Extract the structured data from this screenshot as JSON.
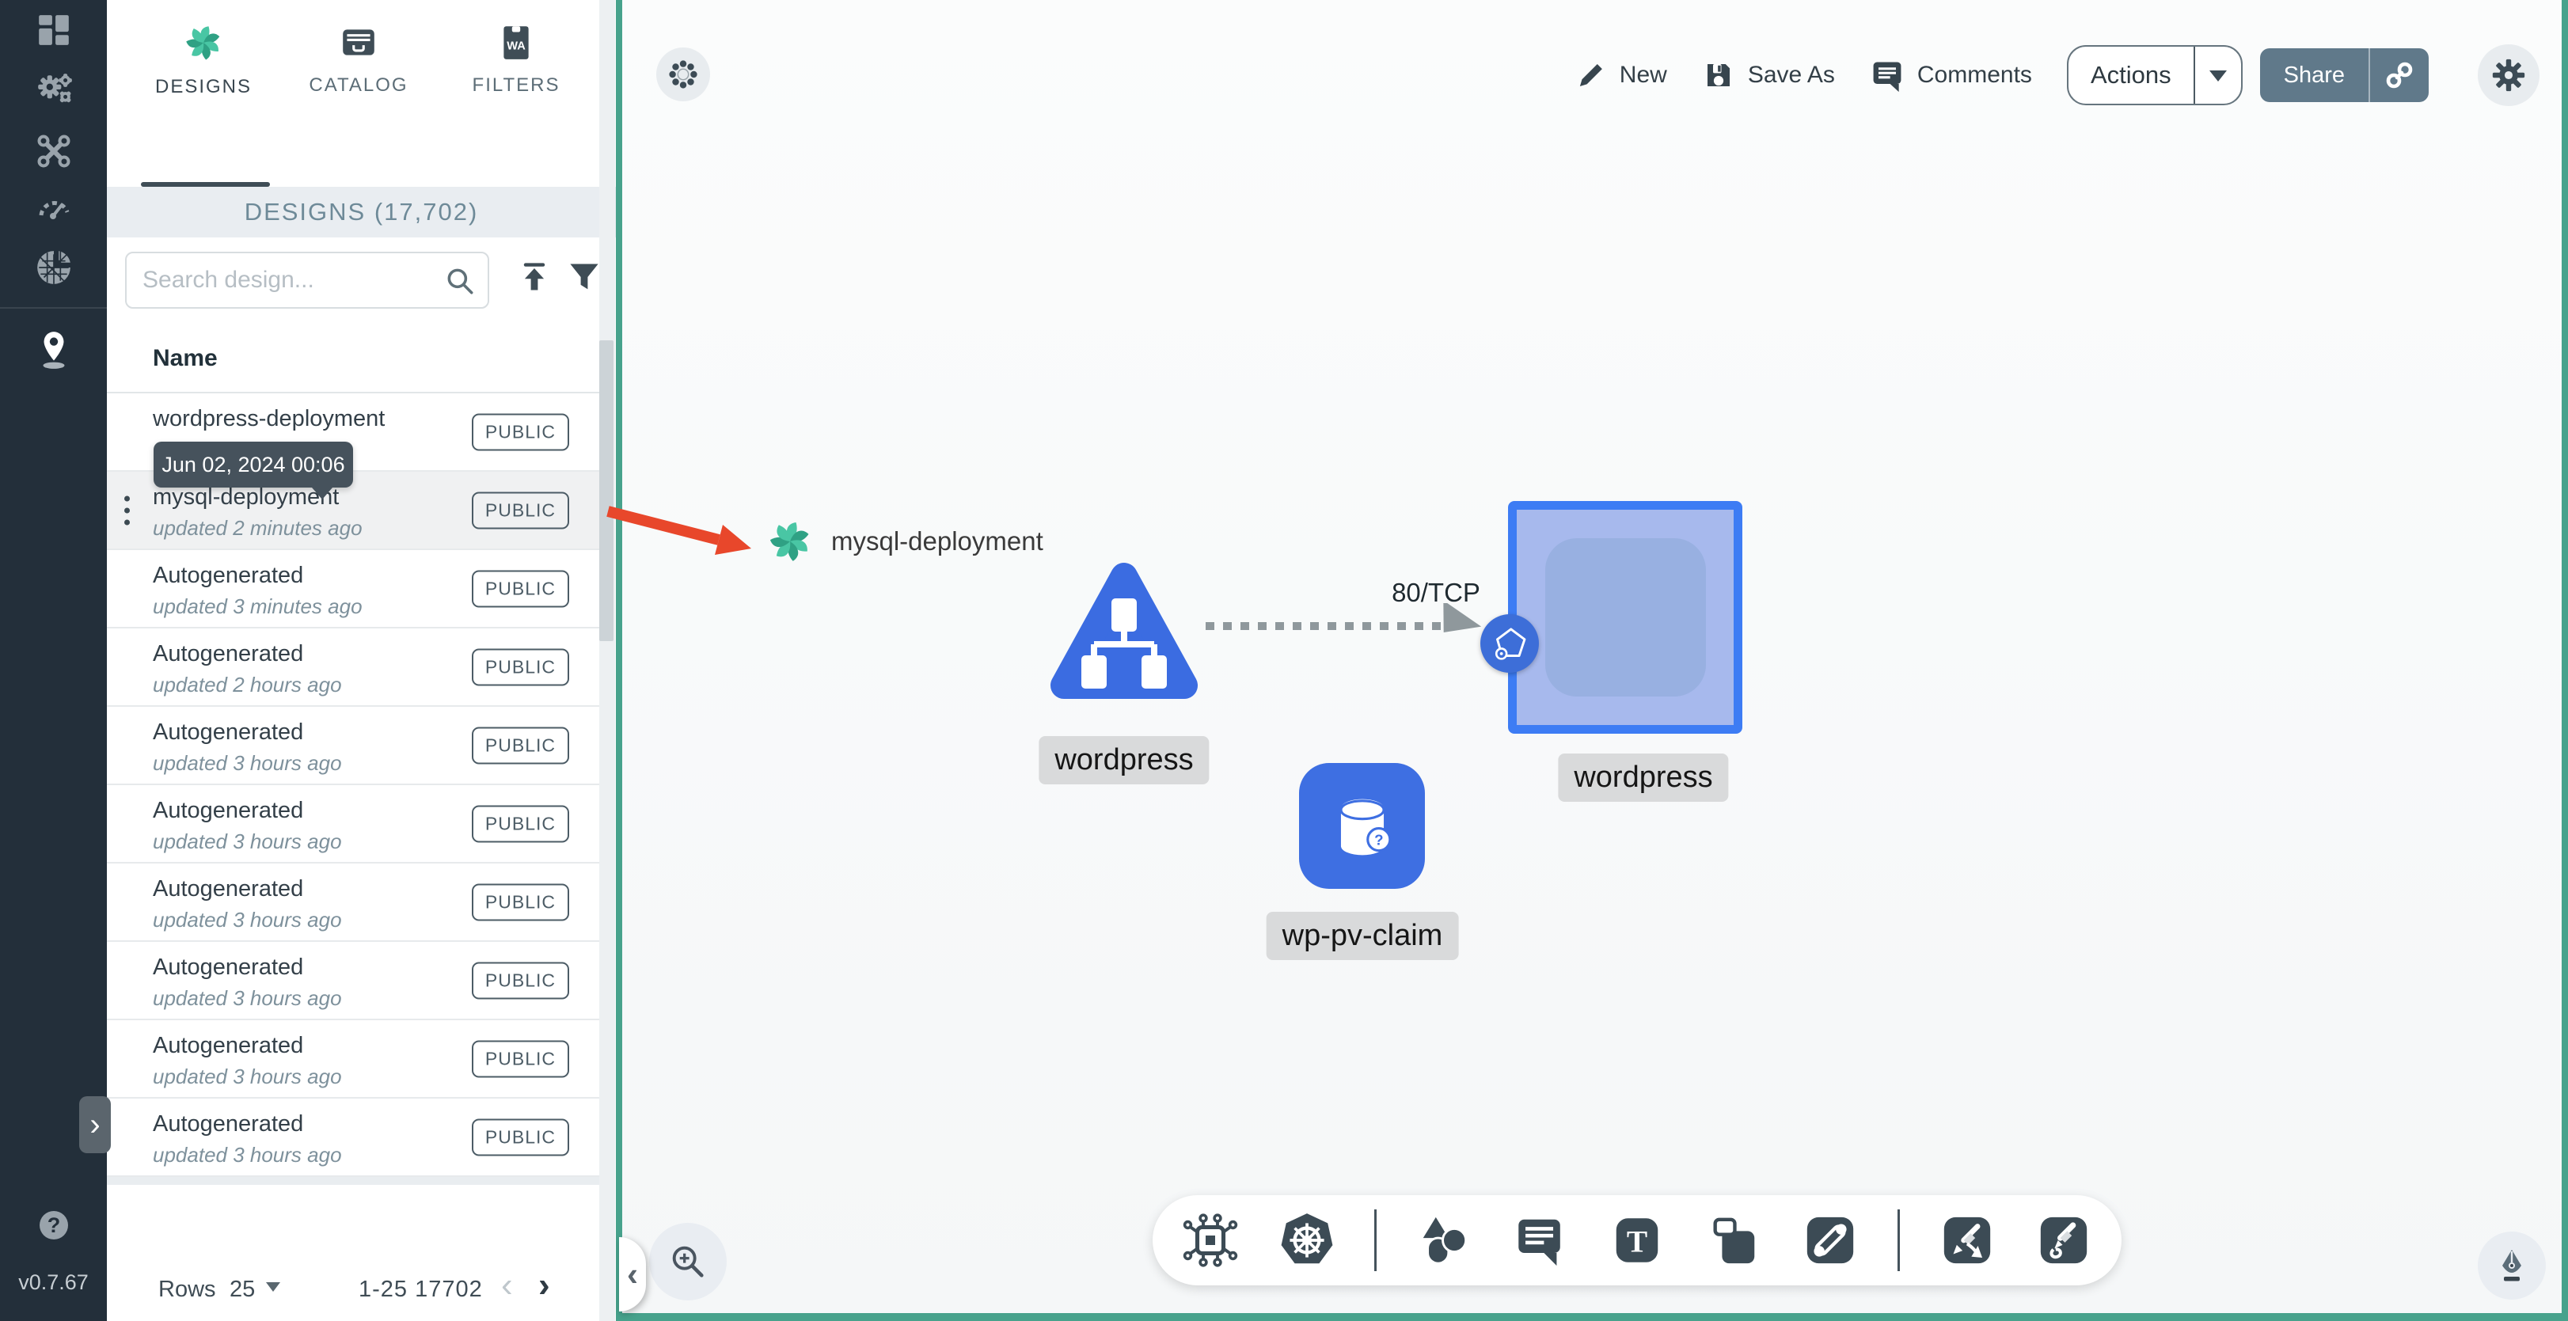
{
  "app": {
    "version": "v0.7.67"
  },
  "nav_rail": {
    "items": [
      {
        "id": "dashboard"
      },
      {
        "id": "lifecycle"
      },
      {
        "id": "configuration"
      },
      {
        "id": "performance"
      },
      {
        "id": "extensions"
      },
      {
        "id": "kanvas",
        "active": true
      }
    ],
    "help": "?"
  },
  "panel": {
    "tabs": [
      {
        "label": "DESIGNS",
        "active": true
      },
      {
        "label": "CATALOG",
        "active": false
      },
      {
        "label": "FILTERS",
        "active": false
      }
    ],
    "filters_icon_text": "WA",
    "header": "DESIGNS (17,702)",
    "search": {
      "placeholder": "Search design..."
    },
    "list_header": "Name",
    "tooltip": "Jun 02, 2024 00:06",
    "rows": [
      {
        "name": "wordpress-deployment",
        "updated": "",
        "badge": "PUBLIC"
      },
      {
        "name": "mysql-deployment",
        "updated": "updated 2 minutes ago",
        "badge": "PUBLIC"
      },
      {
        "name": "Autogenerated",
        "updated": "updated 3 minutes ago",
        "badge": "PUBLIC"
      },
      {
        "name": "Autogenerated",
        "updated": "updated 2 hours ago",
        "badge": "PUBLIC"
      },
      {
        "name": "Autogenerated",
        "updated": "updated 3 hours ago",
        "badge": "PUBLIC"
      },
      {
        "name": "Autogenerated",
        "updated": "updated 3 hours ago",
        "badge": "PUBLIC"
      },
      {
        "name": "Autogenerated",
        "updated": "updated 3 hours ago",
        "badge": "PUBLIC"
      },
      {
        "name": "Autogenerated",
        "updated": "updated 3 hours ago",
        "badge": "PUBLIC"
      },
      {
        "name": "Autogenerated",
        "updated": "updated 3 hours ago",
        "badge": "PUBLIC"
      },
      {
        "name": "Autogenerated",
        "updated": "updated 3 hours ago",
        "badge": "PUBLIC"
      }
    ],
    "footer": {
      "rows_label": "Rows",
      "per_page": "25",
      "range": "1-25 17702",
      "prev": "‹",
      "next": "›"
    },
    "collapse_chevron": "‹"
  },
  "topbar": {
    "new": "New",
    "save_as": "Save As",
    "comments": "Comments",
    "actions": "Actions",
    "share": "Share"
  },
  "canvas": {
    "floating_node_label": "mysql-deployment",
    "edge_label": "80/TCP",
    "deployment_label": "wordpress",
    "service_label": "wordpress",
    "pvc_label": "wp-pv-claim",
    "pvc_badge": "?"
  },
  "colors": {
    "teal_border": "#47a28c",
    "node_blue": "#3c6fe2",
    "square_border": "#3d7cf4",
    "red_arrow": "#e8472b",
    "share_button": "#60798a",
    "rail_bg": "#232f3a"
  }
}
